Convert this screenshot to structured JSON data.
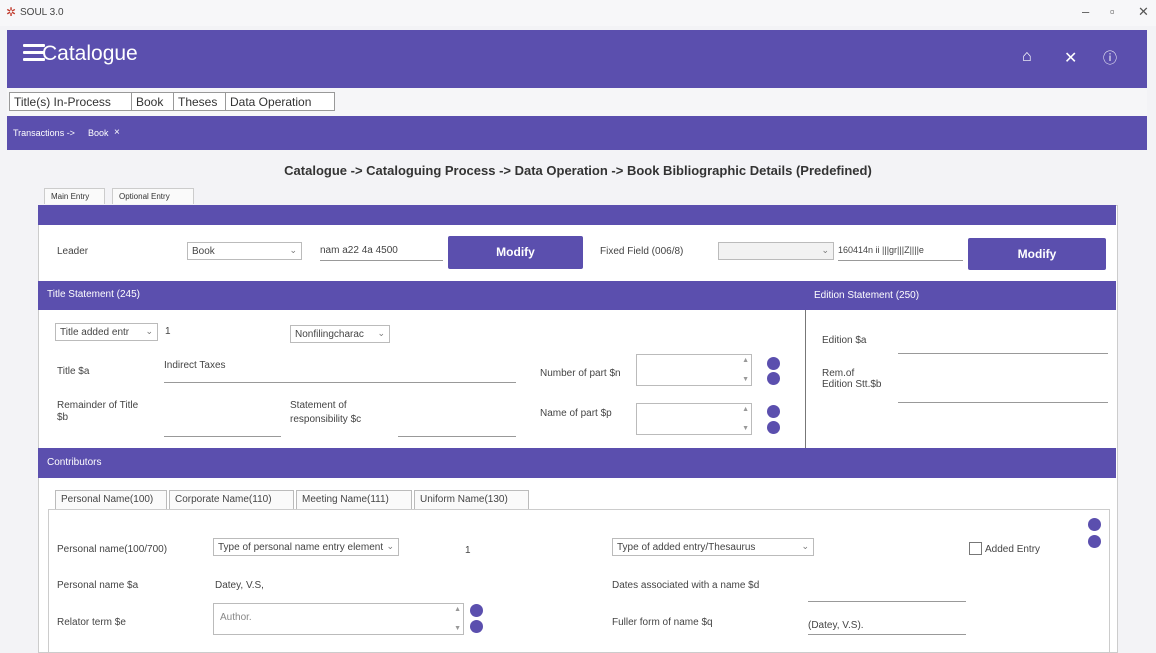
{
  "window": {
    "app_name": "SOUL 3.0",
    "minimize": "–",
    "restore": "▫",
    "close": "✕"
  },
  "header": {
    "title": "Catalogue"
  },
  "main_tabs": [
    {
      "label": "Title(s) In-Process"
    },
    {
      "label": "Book"
    },
    {
      "label": "Theses"
    },
    {
      "label": "Data Operation"
    }
  ],
  "transactions": {
    "label": "Transactions ->",
    "current": "Book",
    "close": "×"
  },
  "page": {
    "heading": "Catalogue -> Cataloguing Process -> Data Operation -> Book Bibliographic Details (Predefined)",
    "entry_tabs": [
      "Main Entry",
      "Optional Entry"
    ]
  },
  "leader": {
    "label": "Leader",
    "type_value": "Book",
    "code": "nam a22   4a 4500",
    "modify_label": "Modify",
    "fixed_field_label": "Fixed Field (006/8)",
    "fixed_field_value": "",
    "fixed_code": "160414n      ii  |||gr|||Z||||e",
    "modify2_label": "Modify"
  },
  "title_statement": {
    "section_title": "Title Statement (245)",
    "added_entry_value": "Title added entr",
    "added_entry_number": "1",
    "nonfiling_value": "Nonfilingcharac",
    "title_label": "Title $a",
    "title_value": "Indirect Taxes",
    "remainder_label_1": "Remainder of Title",
    "remainder_label_2": "$b",
    "responsibility_label_1": "Statement of",
    "responsibility_label_2": "responsibility $c",
    "number_part_label": "Number of part $n",
    "name_part_label": "Name of part $p"
  },
  "edition_statement": {
    "section_title": "Edition Statement (250)",
    "edition_label": "Edition $a",
    "rem_label_1": "Rem.of",
    "rem_label_2": "Edition Stt.$b"
  },
  "contributors": {
    "section_title": "Contributors",
    "tabs": [
      "Personal Name(100)",
      "Corporate Name(110)",
      "Meeting Name(111)",
      "Uniform Name(130)"
    ],
    "personal_name_label": "Personal name(100/700)",
    "entry_element_value": "Type of personal name entry element",
    "entry_number": "1",
    "added_entry_type_value": "Type of added entry/Thesaurus",
    "added_entry_checkbox_label": "Added Entry",
    "name_a_label": "Personal name $a",
    "name_a_value": "Datey, V.S,",
    "dates_label": "Dates associated with a name $d",
    "relator_label": "Relator term $e",
    "relator_value": "Author.",
    "fuller_label": "Fuller form of name $q",
    "fuller_value": "(Datey, V.S)."
  },
  "colors": {
    "accent": "#5b4fae",
    "panel": "#ffffff",
    "background": "#f3f3f6"
  }
}
